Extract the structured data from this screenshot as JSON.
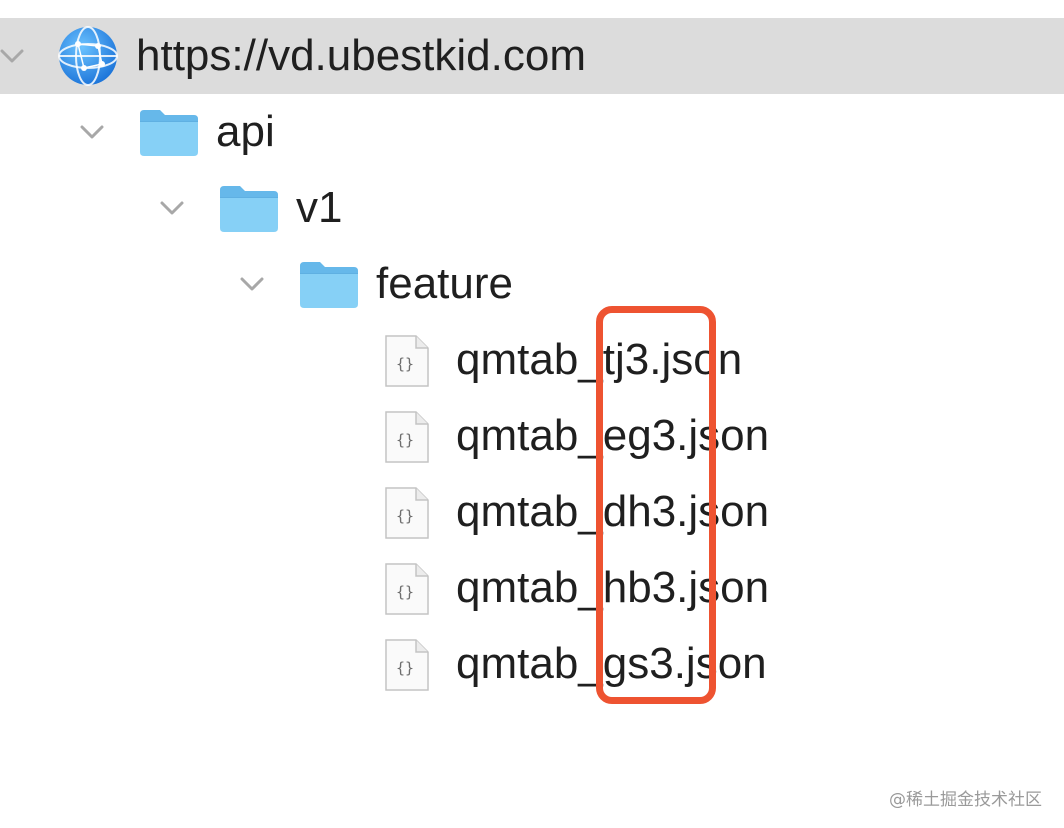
{
  "tree": {
    "root": {
      "label": "https://vd.ubestkid.com",
      "icon": "globe-icon",
      "expanded": true,
      "selected": true
    },
    "api": {
      "label": "api",
      "icon": "folder-icon",
      "expanded": true
    },
    "v1": {
      "label": "v1",
      "icon": "folder-icon",
      "expanded": true
    },
    "feature": {
      "label": "feature",
      "icon": "folder-icon",
      "expanded": true
    },
    "files": [
      {
        "label": "qmtab_tj3.json",
        "icon": "json-file-icon"
      },
      {
        "label": "qmtab_eg3.json",
        "icon": "json-file-icon"
      },
      {
        "label": "qmtab_dh3.json",
        "icon": "json-file-icon"
      },
      {
        "label": "qmtab_hb3.json",
        "icon": "json-file-icon"
      },
      {
        "label": "qmtab_gs3.json",
        "icon": "json-file-icon"
      }
    ]
  },
  "annotation": {
    "color": "#ee5331"
  },
  "colors": {
    "selection": "#dcdcdc",
    "folder": "#7ccaf2",
    "globe": "#2e8ee6"
  },
  "watermark": "@稀土掘金技术社区"
}
